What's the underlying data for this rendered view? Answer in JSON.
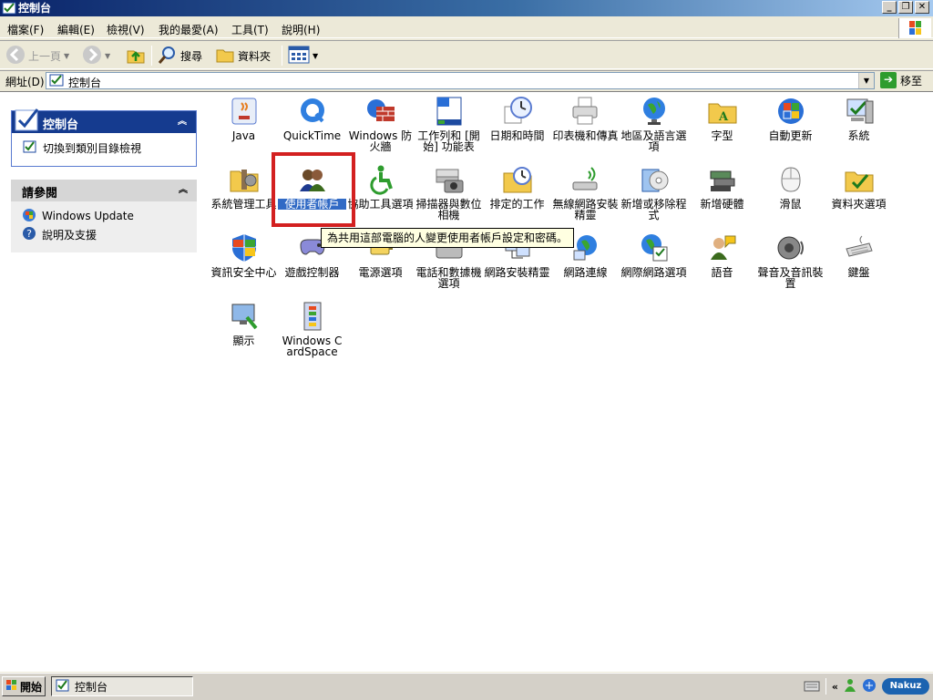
{
  "window": {
    "title": "控制台",
    "buttons": {
      "minimize": "_",
      "maximize": "❐",
      "close": "✕"
    }
  },
  "menu": [
    "檔案(F)",
    "編輯(E)",
    "檢視(V)",
    "我的最愛(A)",
    "工具(T)",
    "說明(H)"
  ],
  "toolbar": {
    "back": "上一頁",
    "search": "搜尋",
    "folders": "資料夾"
  },
  "address": {
    "label": "網址(D)",
    "value": "控制台",
    "go": "移至"
  },
  "panels": {
    "cp": {
      "title": "控制台",
      "link": "切換到類別目錄檢視"
    },
    "see_also": {
      "title": "請參閱",
      "links": [
        "Windows Update",
        "說明及支援"
      ]
    }
  },
  "items": [
    {
      "label": "Java"
    },
    {
      "label": "QuickTime"
    },
    {
      "label": "Windows 防火牆"
    },
    {
      "label": "工作列和 [開始] 功能表"
    },
    {
      "label": "日期和時間"
    },
    {
      "label": "印表機和傳真"
    },
    {
      "label": "地區及語言選項"
    },
    {
      "label": "字型"
    },
    {
      "label": "自動更新"
    },
    {
      "label": "系統"
    },
    {
      "label": "系統管理工具"
    },
    {
      "label": "使用者帳戶"
    },
    {
      "label": "協助工具選項"
    },
    {
      "label": "掃描器與數位相機"
    },
    {
      "label": "排定的工作"
    },
    {
      "label": "無線網路安裝精靈"
    },
    {
      "label": "新增或移除程式"
    },
    {
      "label": "新增硬體"
    },
    {
      "label": "滑鼠"
    },
    {
      "label": "資料夾選項"
    },
    {
      "label": "資訊安全中心"
    },
    {
      "label": "遊戲控制器"
    },
    {
      "label": "電源選項"
    },
    {
      "label": "電話和數據機選項"
    },
    {
      "label": "網路安裝精靈"
    },
    {
      "label": "網路連線"
    },
    {
      "label": "網際網路選項"
    },
    {
      "label": "語音"
    },
    {
      "label": "聲音及音訊裝置"
    },
    {
      "label": "鍵盤"
    },
    {
      "label": "顯示"
    },
    {
      "label": "Windows CardSpace"
    }
  ],
  "tooltip": "為共用這部電腦的人變更使用者帳戶設定和密碼。",
  "taskbar": {
    "start": "開始",
    "task": "控制台",
    "tray_arrows": "«",
    "badge": "Nakuz"
  },
  "colors": {
    "highlight_box": "#d32020",
    "selection": "#316ac5",
    "panel_header": "#153b8f",
    "tooltip_bg": "#ffffe1"
  }
}
